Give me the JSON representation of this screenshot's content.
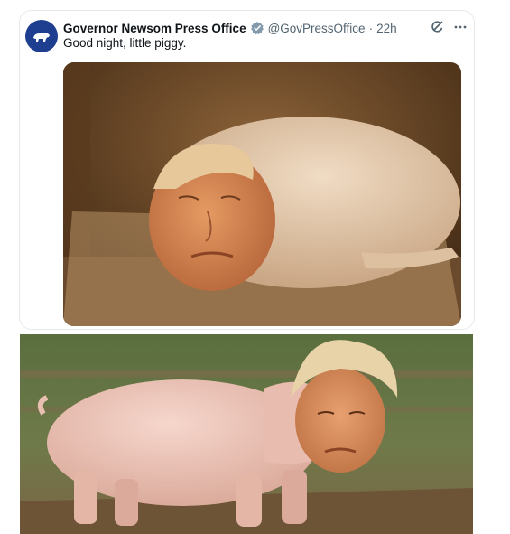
{
  "tweet": {
    "author_name": "Governor Newsom Press Office",
    "handle": "@GovPressOffice",
    "separator": "·",
    "time": "22h",
    "text": "Good night, little piggy."
  },
  "icons": {
    "avatar": "california-bear-icon",
    "verified": "verified-badge-icon",
    "grok": "grok-icon",
    "more": "more-options-icon"
  },
  "colors": {
    "avatar_bg": "#1e3f8f",
    "verified": "#829aab",
    "text": "#0f1419",
    "muted": "#536471"
  }
}
